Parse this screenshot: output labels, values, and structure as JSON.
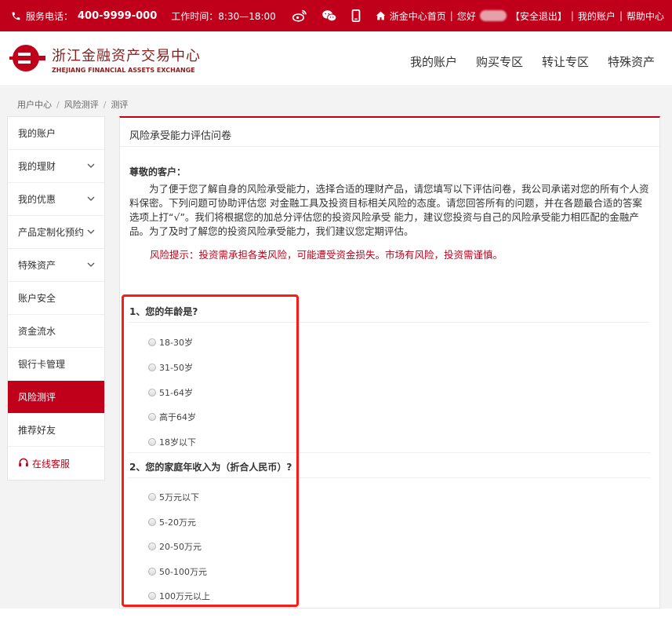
{
  "topbar": {
    "service_label": "服务电话：",
    "phone": "400-9999-000",
    "hours": "工作时间：8:30—18:00",
    "links": {
      "home": "浙金中心首页",
      "hello": "您好",
      "logout": "【安全退出】",
      "account": "我的账户",
      "help": "帮助中心"
    }
  },
  "header": {
    "logo_cn": "浙江金融资产交易中心",
    "logo_en": "ZHEJIANG FINANCIAL ASSETS EXCHANGE",
    "nav": [
      "我的账户",
      "购买专区",
      "转让专区",
      "特殊资产"
    ]
  },
  "breadcrumb": [
    "用户中心",
    "风险测评",
    "测评"
  ],
  "sidebar": {
    "items": [
      {
        "label": "我的账户",
        "chevron": false
      },
      {
        "label": "我的理财",
        "chevron": true
      },
      {
        "label": "我的优惠",
        "chevron": true
      },
      {
        "label": "产品定制化预约",
        "chevron": true
      },
      {
        "label": "特殊资产",
        "chevron": true
      },
      {
        "label": "账户安全",
        "chevron": false
      },
      {
        "label": "资金流水",
        "chevron": false
      },
      {
        "label": "银行卡管理",
        "chevron": false
      },
      {
        "label": "风险测评",
        "chevron": false,
        "active": true
      },
      {
        "label": "推荐好友",
        "chevron": false
      }
    ],
    "service": "在线客服"
  },
  "main": {
    "title": "风险承受能力评估问卷",
    "greeting": "尊敬的客户：",
    "intro": "为了便于您了解自身的风险承受能力，选择合适的理财产品，请您填写以下评估问卷，我公司承诺对您的所有个人资料保密。下列问题可协助评估您 对金融工具及投资目标相关风险的态度。请您回答所有的问题，并在各题最合适的答案选项上打“√”。我们将根据您的加总分评估您的投资风险承受 能力，建议您投资与自己的风险承受能力相匹配的金融产品。为了及时了解您的投资风险承受能力，我们建议您定期评估。",
    "risk_notice": "风险提示：投资需承担各类风险，可能遭受资金损失。市场有风险，投资需谨慎。",
    "questions": [
      {
        "title": "1、您的年龄是?",
        "options": [
          "18-30岁",
          "31-50岁",
          "51-64岁",
          "高于64岁",
          "18岁以下"
        ]
      },
      {
        "title": "2、您的家庭年收入为（折合人民币）?",
        "options": [
          "5万元以下",
          "5-20万元",
          "20-50万元",
          "50-100万元",
          "100万元以上"
        ]
      }
    ]
  },
  "colors": {
    "brand_red": "#c0001a",
    "highlight_red": "#ff1a1a"
  }
}
